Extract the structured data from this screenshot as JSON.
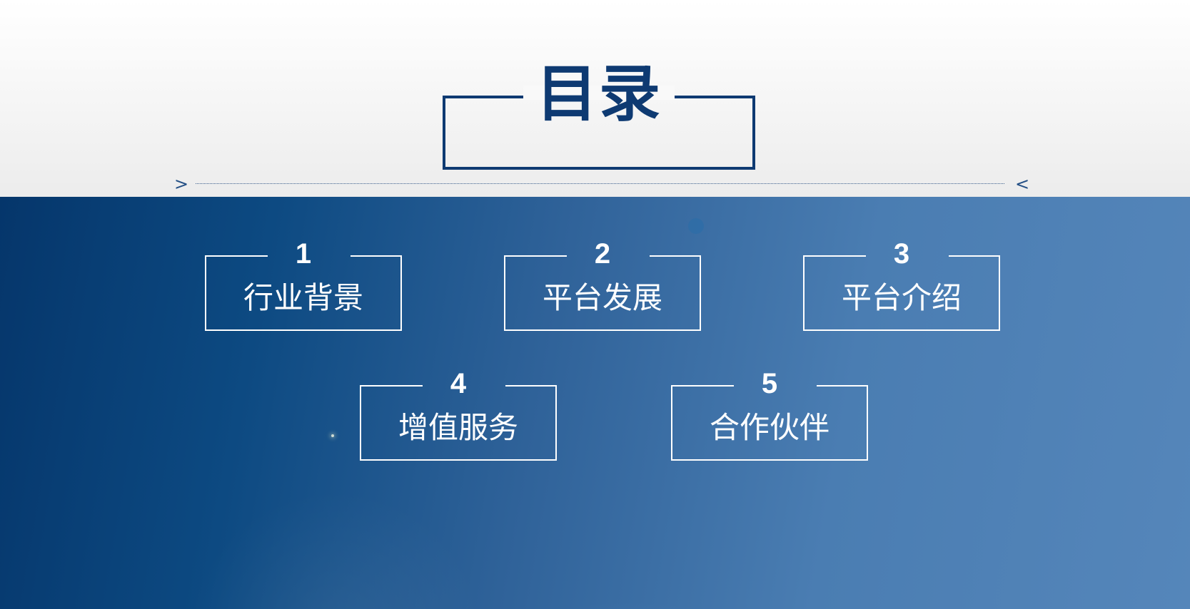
{
  "title": "目录",
  "divider": {
    "left_arrow": ">",
    "right_arrow": "<"
  },
  "toc": [
    {
      "number": "1",
      "label": "行业背景"
    },
    {
      "number": "2",
      "label": "平台发展"
    },
    {
      "number": "3",
      "label": "平台介绍"
    },
    {
      "number": "4",
      "label": "增值服务"
    },
    {
      "number": "5",
      "label": "合作伙伴"
    }
  ],
  "colors": {
    "title": "#0e3a72",
    "background_dark": "#05366b",
    "background_light": "#5586ba",
    "item_text": "#ffffff"
  }
}
